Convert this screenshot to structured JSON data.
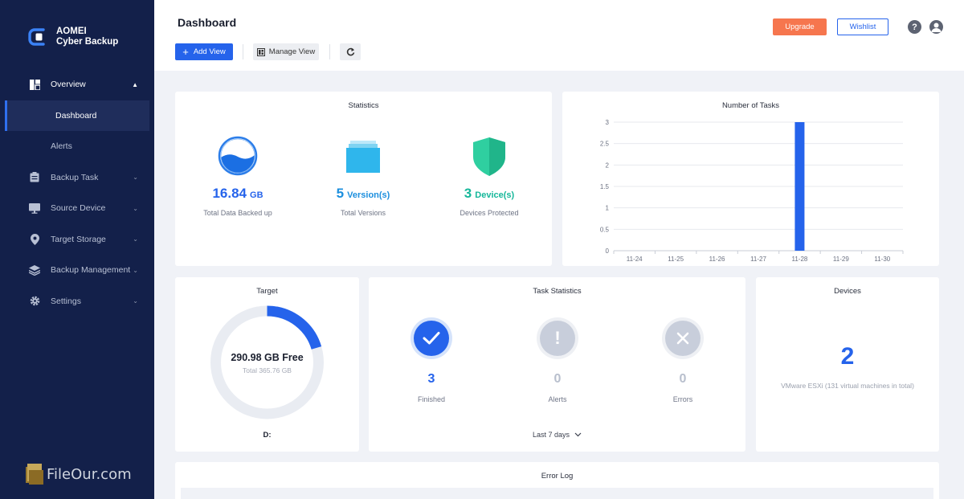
{
  "app": {
    "brand_line1": "AOMEI",
    "brand_line2": "Cyber Backup"
  },
  "sidebar": {
    "items": [
      {
        "label": "Overview",
        "icon": "dashboard-icon"
      },
      {
        "label": "Dashboard",
        "sub": true
      },
      {
        "label": "Alerts",
        "sub": true
      },
      {
        "label": "Backup Task",
        "icon": "clipboard-icon"
      },
      {
        "label": "Source Device",
        "icon": "monitor-icon"
      },
      {
        "label": "Target Storage",
        "icon": "location-pin-icon"
      },
      {
        "label": "Backup Management",
        "icon": "layers-icon"
      },
      {
        "label": "Settings",
        "icon": "gear-icon"
      }
    ]
  },
  "header": {
    "title": "Dashboard",
    "add_view": "Add View",
    "manage_view": "Manage View",
    "upgrade": "Upgrade",
    "wishlist": "Wishlist"
  },
  "statistics": {
    "title": "Statistics",
    "data": {
      "value": "16.84",
      "unit": "GB",
      "label": "Total Data Backed up"
    },
    "versions": {
      "value": "5",
      "unit": "Version(s)",
      "label": "Total Versions"
    },
    "devices": {
      "value": "3",
      "unit": "Device(s)",
      "label": "Devices Protected"
    }
  },
  "tasks_chart": {
    "title": "Number of Tasks"
  },
  "chart_data": {
    "type": "bar",
    "title": "Number of Tasks",
    "categories": [
      "11-24",
      "11-25",
      "11-26",
      "11-27",
      "11-28",
      "11-29",
      "11-30"
    ],
    "values": [
      0,
      0,
      0,
      0,
      3,
      0,
      0
    ],
    "ylim": [
      0,
      3
    ],
    "yticks": [
      "0",
      "0.5",
      "1",
      "1.5",
      "2",
      "2.5",
      "3"
    ],
    "color": "#2563eb",
    "grid": true
  },
  "target": {
    "title": "Target",
    "free": "290.98 GB Free",
    "total": "Total 365.76 GB",
    "drive": "D:",
    "used_fraction": 0.2045
  },
  "task_stats": {
    "title": "Task Statistics",
    "finished": {
      "value": "3",
      "label": "Finished"
    },
    "alerts": {
      "value": "0",
      "label": "Alerts"
    },
    "errors": {
      "value": "0",
      "label": "Errors"
    },
    "period": "Last 7 days"
  },
  "devices": {
    "title": "Devices",
    "count": "2",
    "desc": "VMware ESXi (131 virtual machines in total)"
  },
  "error_log": {
    "title": "Error Log"
  },
  "watermark": {
    "text": "FileOur.com"
  },
  "colors": {
    "accent": "#2563eb",
    "teal": "#16b79a",
    "upgrade": "#f6764e",
    "sidebar": "#13204a"
  }
}
